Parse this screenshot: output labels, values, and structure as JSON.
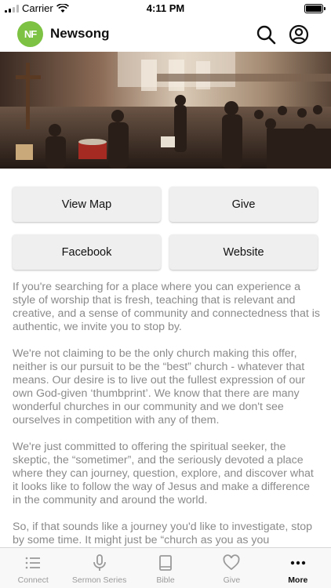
{
  "status_bar": {
    "carrier": "Carrier",
    "time": "4:11 PM"
  },
  "header": {
    "logo_text": "NF",
    "title": "Newsong",
    "brand_color": "#7dc242"
  },
  "hero": {
    "image_description_icon": "church-worship-photo"
  },
  "actions": [
    {
      "label": "View Map"
    },
    {
      "label": "Give"
    },
    {
      "label": "Facebook"
    },
    {
      "label": "Website"
    }
  ],
  "description": [
    "If you're searching for a place where you can experience a style of worship that is fresh, teaching that is relevant and creative, and a sense of community and connectedness that is authentic, we invite you to stop by.",
    "We're not claiming to be the only church making this offer, neither is our pursuit to be the “best” church - whatever that means.  Our desire is to live out the fullest expression of our own God-given ‘thumbprint’.  We know that there are many wonderful churches in our community and we don't see ourselves in competition with any of them.",
    "We're just committed to offering the spiritual seeker, the skeptic, the “sometimer”, and the seriously devoted a place where they can journey, question, explore, and discover what it looks like to follow the way of Jesus and make a difference in the community and around the world.",
    "So, if that sounds like a journey you'd like to investigate, stop by some time.  It might just be “church as you as you"
  ],
  "tabs": [
    {
      "label": "Connect",
      "icon": "list-icon",
      "active": false
    },
    {
      "label": "Sermon Series",
      "icon": "microphone-icon",
      "active": false
    },
    {
      "label": "Bible",
      "icon": "book-icon",
      "active": false
    },
    {
      "label": "Give",
      "icon": "heart-icon",
      "active": false
    },
    {
      "label": "More",
      "icon": "more-icon",
      "active": true
    }
  ]
}
